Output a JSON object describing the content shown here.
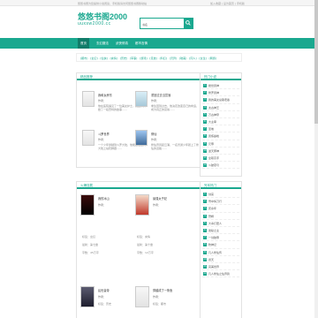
{
  "topbar": {
    "left_text": "悠悠书阁为您提供小说阅读，手机版请访问悠悠书阁移动站",
    "right_text": "加入收藏 | 设为首页 | 手机版"
  },
  "logo": {
    "title": "悠悠书阁2000",
    "subtitle": "uuxsw2000.cc"
  },
  "search": {
    "value": "书名",
    "placeholder": "书名",
    "button_icon": "search-icon"
  },
  "nav": {
    "items": [
      "首页",
      "玄幻魔法",
      "武侠修真",
      "都市言情"
    ]
  },
  "tags": {
    "text": "[都市] · [玄幻] · [仙侠] · [言情] · [历史] · [军事] · [游戏] · [竞技] · [科幻] · [灵异] · [耽美] · [同人] · [女生] · [网游]"
  },
  "panels": {
    "hot_title": "精品推荐",
    "new_title": "火爆连载",
    "rank_title": "热门小说",
    "rank2_title": "完本热门"
  },
  "hot_books": [
    {
      "title": "我和女房东",
      "author": "作者：",
      "desc": "他在医院遇见了一位美女护士，就这样开始了一段奇特的故事……"
    },
    {
      "title": "重回过去当富翁",
      "author": "作者：",
      "desc": "重生回到过去，他决定改变自己的命运，成为真正的富翁……"
    },
    {
      "title": "斗罗世界",
      "author": "作者：",
      "desc": "一个少年穿越到斗罗大陆，他能否在这片大陆上站稳脚跟……"
    },
    {
      "title": "修仙",
      "author": "作者：",
      "desc": "修仙界风起云涌，一名普通少年踏上了修仙的道路……"
    }
  ],
  "new_books": [
    {
      "title": "我的冰山",
      "author": "作者：",
      "info": [
        "标签：玄幻",
        "最新：第七章",
        "字数：45万字"
      ]
    },
    {
      "title": "最强太子妃",
      "author": "作者：",
      "info": [
        "标签：言情",
        "最新：第十章",
        "字数：12万字"
      ]
    },
    {
      "title": "乱世皇帝",
      "author": "作者：",
      "info": [
        "标签：历史",
        "最新：第三章"
      ]
    },
    {
      "title": "穿越成了一条鱼",
      "author": "作者：",
      "info": [
        "标签：都市",
        "最新：第二章"
      ]
    }
  ],
  "rank": [
    "绝世武神",
    "修罗武神",
    "我的美女总裁老婆",
    "太古神王",
    "万古神帝",
    "大主宰",
    "圣墟",
    "武炼巅峰",
    "元尊",
    "逆天邪神",
    "全职高手",
    "斗破苍穹"
  ],
  "rank2": [
    "剑来",
    "雪中悍刀行",
    "庆余年",
    "赘婿",
    "大奉打更人",
    "诡秘之主",
    "一剑独尊",
    "牧神记",
    "凡人修仙传",
    "遮天",
    "完美世界",
    "凡人修仙之仙界篇"
  ],
  "colors": {
    "accent": "#1aa88f",
    "accent_dark": "#117c69",
    "border": "#e2e2e2"
  }
}
